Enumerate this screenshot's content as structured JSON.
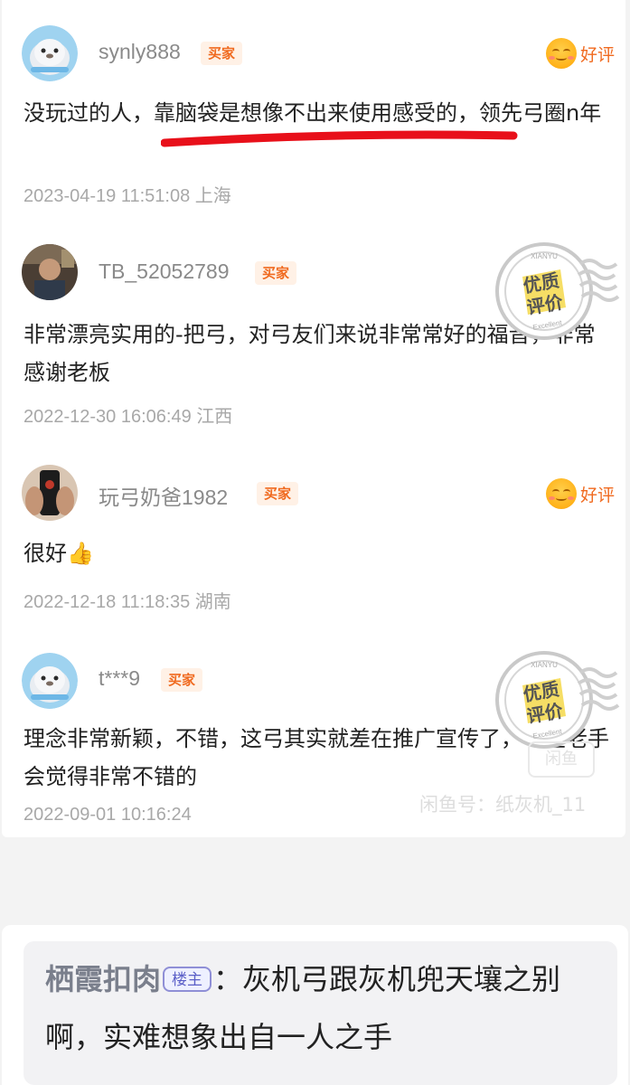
{
  "reviews": [
    {
      "username": "synly888",
      "badge": "买家",
      "rating": "好评",
      "content": "没玩过的人，靠脑袋是想像不出来使用感受的，领先弓圈n年",
      "meta": "2023-04-19 11:51:08 上海",
      "avatar": "seal-avatar"
    },
    {
      "username": "TB_52052789",
      "badge": "买家",
      "content": "非常漂亮实用的-把弓，对弓友们来说非常常好的福音，非常感谢老板",
      "meta": "2022-12-30 16:06:49 江西",
      "avatar": "photo-avatar",
      "stamp": {
        "top": "XIANYU",
        "line1": "优质",
        "line2": "评价",
        "bottom": "Excellent"
      }
    },
    {
      "username": "玩弓奶爸1982",
      "badge": "买家",
      "rating": "好评",
      "content": "很好👍",
      "meta": "2022-12-18 11:18:35 湖南",
      "avatar": "hand-avatar"
    },
    {
      "username": "t***9",
      "badge": "买家",
      "content": "理念非常新颖，不错，这弓其实就差在推广宣传了，一些老手会觉得非常不错的",
      "meta": "2022-09-01 10:16:24",
      "avatar": "seal-avatar",
      "stamp": {
        "top": "XIANYU",
        "line1": "优质",
        "line2": "评价",
        "bottom": "Excellent"
      }
    }
  ],
  "watermark": {
    "logo_text": "闲鱼",
    "id_text": "闲鱼号：纸灰机_11"
  },
  "reply": {
    "name": "栖霞扣肉",
    "owner_tag": "楼主",
    "text": "：灰机弓跟灰机兜天壤之别啊，实难想象出自一人之手"
  },
  "colors": {
    "badge": "#f06a1f",
    "underline": "#e8101a",
    "owner_tag": "#5b5fc7"
  }
}
